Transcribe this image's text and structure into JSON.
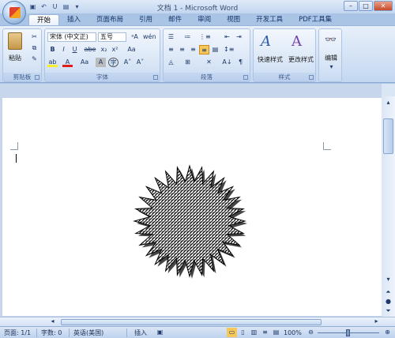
{
  "window": {
    "title": "文档 1 - Microsoft Word"
  },
  "quick_access": {
    "save_icon": "save-icon",
    "undo_icon": "undo-icon",
    "redo_icon": "redo-icon"
  },
  "tabs": [
    {
      "label": "开始",
      "active": true
    },
    {
      "label": "插入"
    },
    {
      "label": "页面布局"
    },
    {
      "label": "引用"
    },
    {
      "label": "邮件"
    },
    {
      "label": "审阅"
    },
    {
      "label": "视图"
    },
    {
      "label": "开发工具"
    },
    {
      "label": "PDF工具集"
    }
  ],
  "ribbon": {
    "clipboard": {
      "label": "剪贴板",
      "paste": "粘贴"
    },
    "font": {
      "label": "字体",
      "font_name": "宋体 (中文正)",
      "font_size": "五号",
      "bold": "B",
      "italic": "I",
      "underline": "U",
      "strike": "abe",
      "sub": "x₂",
      "sup": "x²",
      "grow": "A˄",
      "shrink": "A˅",
      "case": "Aa",
      "char_shade": "A",
      "enclose": "字",
      "wen": "wén"
    },
    "paragraph": {
      "label": "段落"
    },
    "styles": {
      "label": "样式",
      "quick_styles": "快速样式",
      "change_styles": "更改样式"
    },
    "editing": {
      "label": "编辑",
      "edit": "编辑"
    }
  },
  "status": {
    "page": "页面: 1/1",
    "words": "字数: 0",
    "language": "英语(美国)",
    "mode": "插入",
    "zoom": "100%"
  },
  "colors": {
    "accent": "#2b579a",
    "ribbon_bg": "#cfdff4",
    "font_color": "#e21b1b",
    "highlight": "#f4ee2b"
  }
}
